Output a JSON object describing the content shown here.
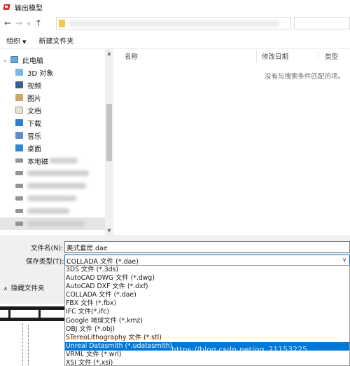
{
  "window": {
    "title": "输出模型"
  },
  "toolbar": {
    "organize_label": "组织",
    "new_folder_label": "新建文件夹"
  },
  "nav": {
    "items": [
      {
        "label": "此电脑",
        "icon": "computer-icon"
      },
      {
        "label": "3D 对象",
        "icon": "3d-objects-icon"
      },
      {
        "label": "视频",
        "icon": "video-folder-icon"
      },
      {
        "label": "图片",
        "icon": "pictures-folder-icon"
      },
      {
        "label": "文档",
        "icon": "documents-folder-icon"
      },
      {
        "label": "下载",
        "icon": "downloads-folder-icon"
      },
      {
        "label": "音乐",
        "icon": "music-folder-icon"
      },
      {
        "label": "桌面",
        "icon": "desktop-folder-icon"
      },
      {
        "label": "本地磁",
        "icon": "drive-icon"
      }
    ]
  },
  "filelist": {
    "columns": {
      "name": "名称",
      "modified": "修改日期",
      "type": "类型"
    },
    "empty_message": "没有与搜索条件匹配的项。"
  },
  "form": {
    "filename_label": "文件名(N):",
    "filename_value": "美式套房.dae",
    "filetype_label": "保存类型(T):",
    "filetype_value": "COLLADA 文件 (*.dae)",
    "hide_folders_label": "隐藏文件夹"
  },
  "dropdown": {
    "options": [
      "3DS 文件 (*.3ds)",
      "AutoCAD DWG 文件 (*.dwg)",
      "AutoCAD DXF 文件 (*.dxf)",
      "COLLADA 文件 (*.dae)",
      "FBX 文件 (*.fbx)",
      "IFC 文件(*.ifc)",
      "Google 地球文件 (*.kmz)",
      "OBJ 文件 (*.obj)",
      "STereoLithography 文件 (*.stl)",
      "Unreal Datasmith (*.udatasmith)",
      "VRML 文件 (*.wrl)",
      "XSI 文件 (*.xsi)"
    ],
    "selected_index": 9
  },
  "watermark": "https://blog.csdn.net/qq_21153225",
  "colors": {
    "accent": "#0078d7",
    "selected_text": "#ffffff"
  }
}
